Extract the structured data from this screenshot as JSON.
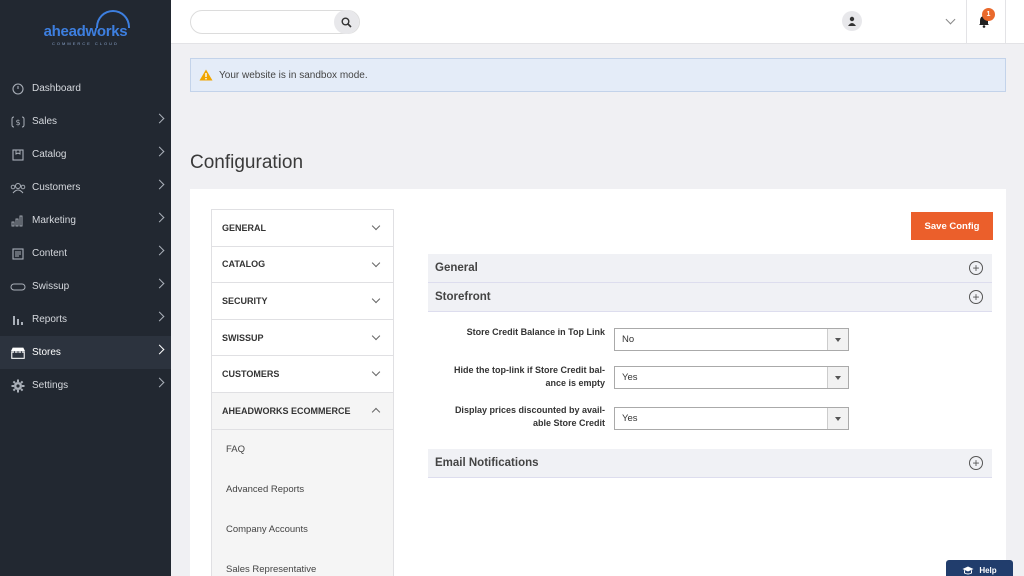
{
  "logo": {
    "word": "aheadworks",
    "subtitle": "COMMERCE CLOUD"
  },
  "sidebar": {
    "items": [
      {
        "label": "Dashboard",
        "icon": "dashboard-icon",
        "has_children": false
      },
      {
        "label": "Sales",
        "icon": "dollar-icon",
        "has_children": true
      },
      {
        "label": "Catalog",
        "icon": "catalog-icon",
        "has_children": true
      },
      {
        "label": "Customers",
        "icon": "customers-icon",
        "has_children": true
      },
      {
        "label": "Marketing",
        "icon": "marketing-icon",
        "has_children": true
      },
      {
        "label": "Content",
        "icon": "content-icon",
        "has_children": true
      },
      {
        "label": "Swissup",
        "icon": "swissup-icon",
        "has_children": true
      },
      {
        "label": "Reports",
        "icon": "reports-icon",
        "has_children": true
      },
      {
        "label": "Stores",
        "icon": "stores-icon",
        "has_children": true,
        "active": true
      },
      {
        "label": "Settings",
        "icon": "gear-icon",
        "has_children": true
      }
    ]
  },
  "topbar": {
    "search_placeholder": "",
    "notification_count": "1"
  },
  "alert": {
    "text": "Your website is in sandbox mode."
  },
  "page": {
    "title": "Configuration"
  },
  "config_tabs": [
    {
      "label": "GENERAL",
      "expanded": false
    },
    {
      "label": "CATALOG",
      "expanded": false
    },
    {
      "label": "SECURITY",
      "expanded": false
    },
    {
      "label": "SWISSUP",
      "expanded": false
    },
    {
      "label": "CUSTOMERS",
      "expanded": false
    },
    {
      "label": "AHEADWORKS ECOMMERCE",
      "expanded": true
    }
  ],
  "subtabs": [
    "FAQ",
    "Advanced Reports",
    "Company Accounts",
    "Sales Representative"
  ],
  "actions": {
    "save_label": "Save Config"
  },
  "sections": {
    "general": "General",
    "storefront": "Storefront",
    "email": "Email Notifications"
  },
  "fields": [
    {
      "label": "Store Credit Balance in Top Link",
      "value": "No"
    },
    {
      "label": "Hide the top-link if Store Credit balance is empty",
      "label_line1": "Hide the top-link if Store Credit bal-",
      "label_line2": "ance is empty",
      "value": "Yes"
    },
    {
      "label": "Display prices discounted by available Store Credit",
      "label_line1": "Display prices discounted by avail-",
      "label_line2": "able Store Credit",
      "value": "Yes"
    }
  ],
  "help": {
    "label": "Help"
  },
  "colors": {
    "accent": "#eb5f2b",
    "sidebar_bg": "#222831",
    "brand_blue": "#3d7fe0",
    "help_bg": "#213d6c"
  }
}
